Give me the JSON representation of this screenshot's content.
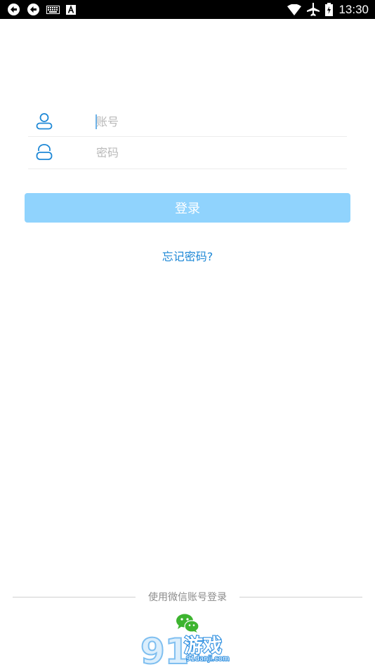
{
  "status_bar": {
    "time": "13:30",
    "left_icons": [
      "sync-icon",
      "sync-icon",
      "keyboard-icon",
      "text-a-icon"
    ],
    "right_icons": [
      "wifi-icon",
      "airplane-icon",
      "battery-icon"
    ]
  },
  "login_form": {
    "account_placeholder": "账号",
    "password_placeholder": "密码",
    "account_icon": "user-icon",
    "password_icon": "lock-icon"
  },
  "login_button": {
    "label": "登录"
  },
  "forgot_password": {
    "label": "忘记密码?"
  },
  "third_party": {
    "divider_label": "使用微信账号登录",
    "wechat_icon": "wechat-icon"
  },
  "watermark": {
    "logo_text": "91游戏",
    "site": "91danji.com"
  },
  "colors": {
    "accent": "#1e88d6",
    "button_bg": "#90d3fd",
    "wechat_green": "#3db42f"
  }
}
